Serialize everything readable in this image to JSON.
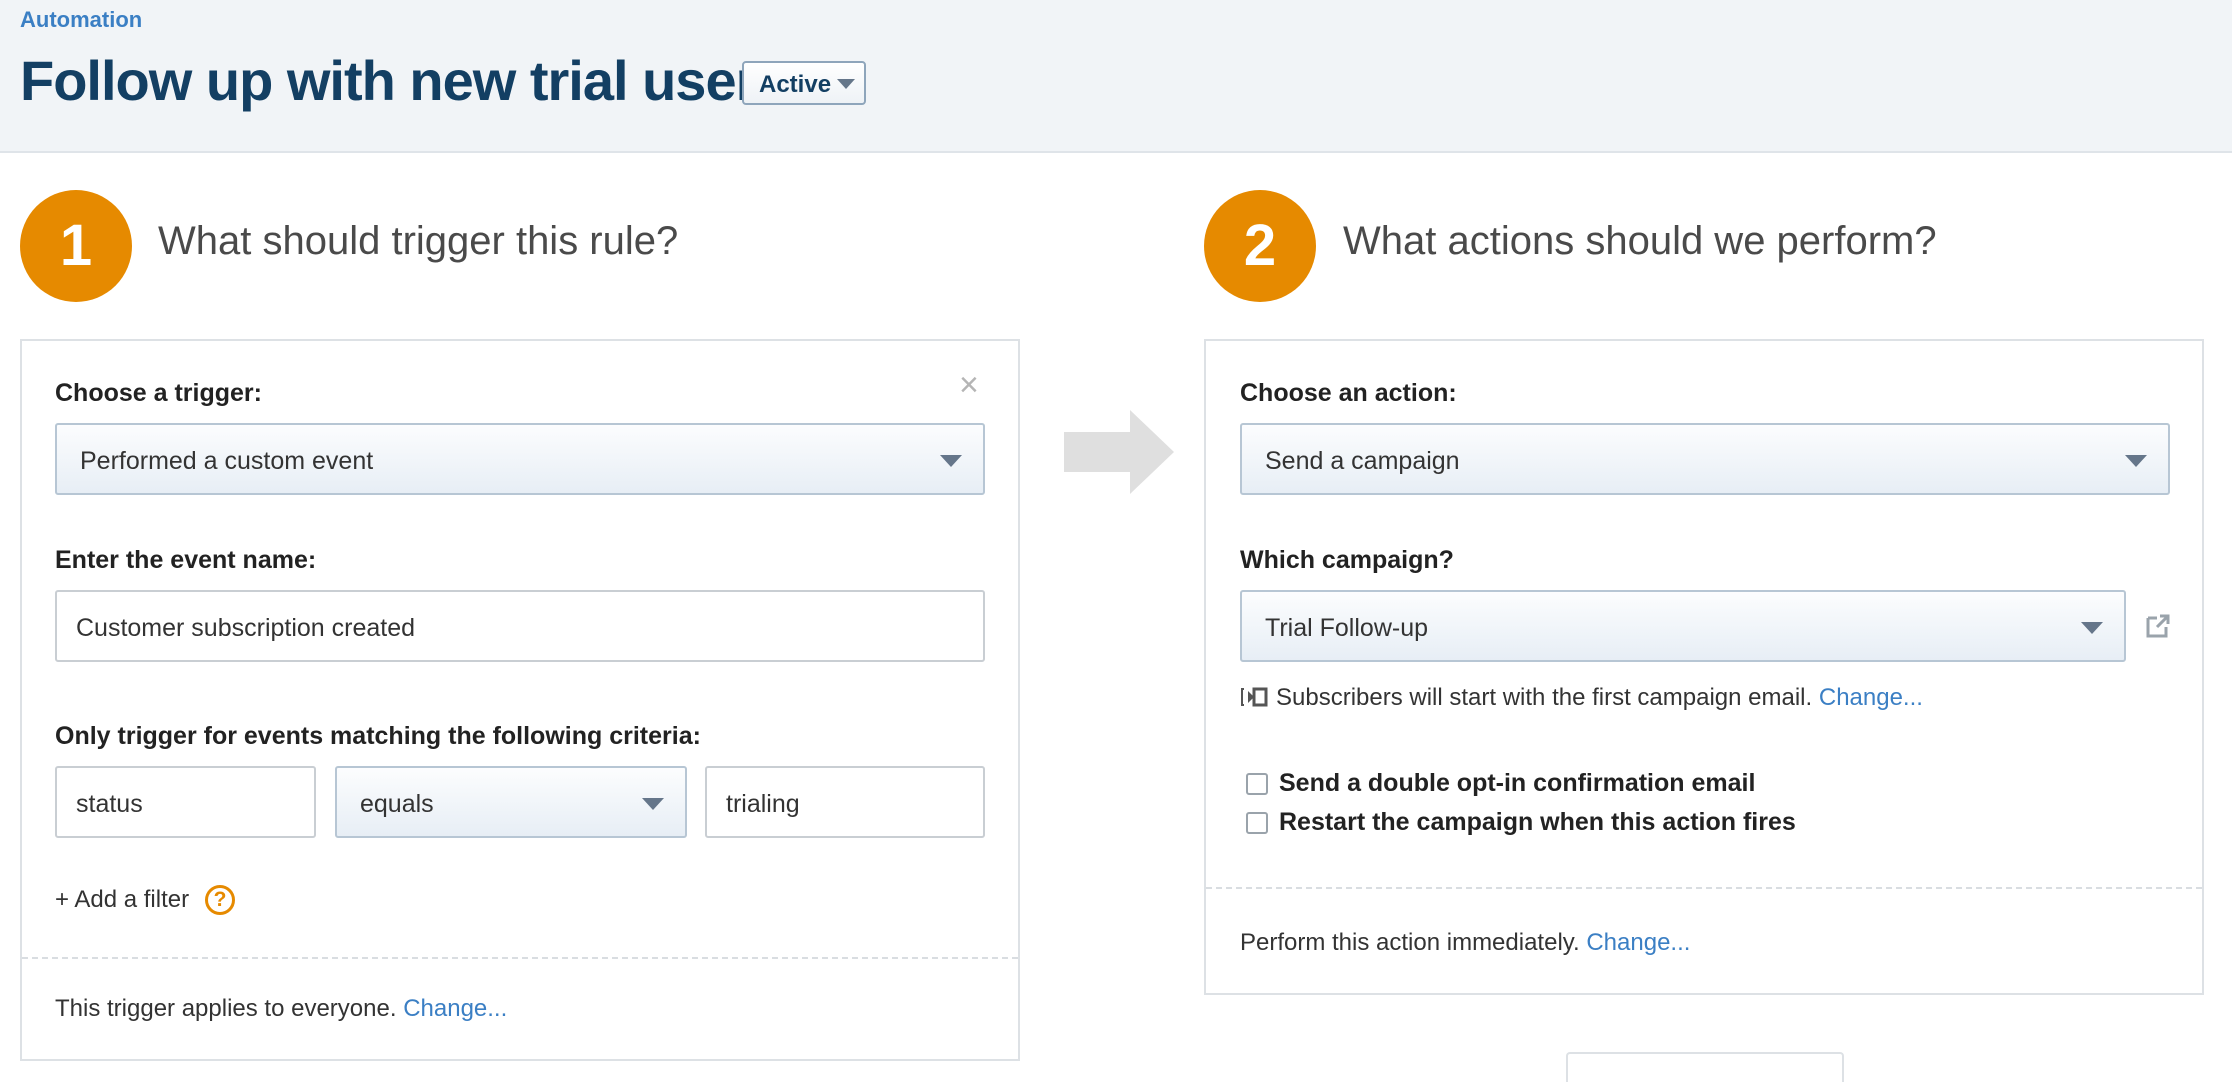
{
  "header": {
    "breadcrumb": "Automation",
    "title": "Follow up with new trial users",
    "status": "Active"
  },
  "trigger": {
    "step_number": "1",
    "heading": "What should trigger this rule?",
    "close_icon": "×",
    "trigger_label": "Choose a trigger:",
    "trigger_value": "Performed a custom event",
    "event_label": "Enter the event name:",
    "event_value": "Customer subscription created",
    "criteria_label": "Only trigger for events matching the following criteria:",
    "filter": {
      "field": "status",
      "operator": "equals",
      "value": "trialing"
    },
    "add_filter": "+ Add a filter",
    "help_icon": "?",
    "applies_text": "This trigger applies to everyone.",
    "change_link": "Change..."
  },
  "action": {
    "step_number": "2",
    "heading": "What actions should we perform?",
    "action_label": "Choose an action:",
    "action_value": "Send a campaign",
    "campaign_label": "Which campaign?",
    "campaign_value": "Trial Follow-up",
    "subscribers_text": "Subscribers will start with the first campaign email.",
    "change_link": "Change...",
    "checkboxes": [
      {
        "label": "Send a double opt-in confirmation email",
        "checked": false
      },
      {
        "label": "Restart the campaign when this action fires",
        "checked": false
      }
    ],
    "timing_text": "Perform this action immediately.",
    "timing_change_link": "Change..."
  },
  "icons": {
    "arrow": "right-arrow-icon",
    "external_link": "external-link-icon",
    "entry_point": "entry-point-icon"
  },
  "colors": {
    "accent": "#e68a00",
    "link": "#3b7fc4",
    "title": "#133f63",
    "header_bg": "#f1f4f7"
  }
}
